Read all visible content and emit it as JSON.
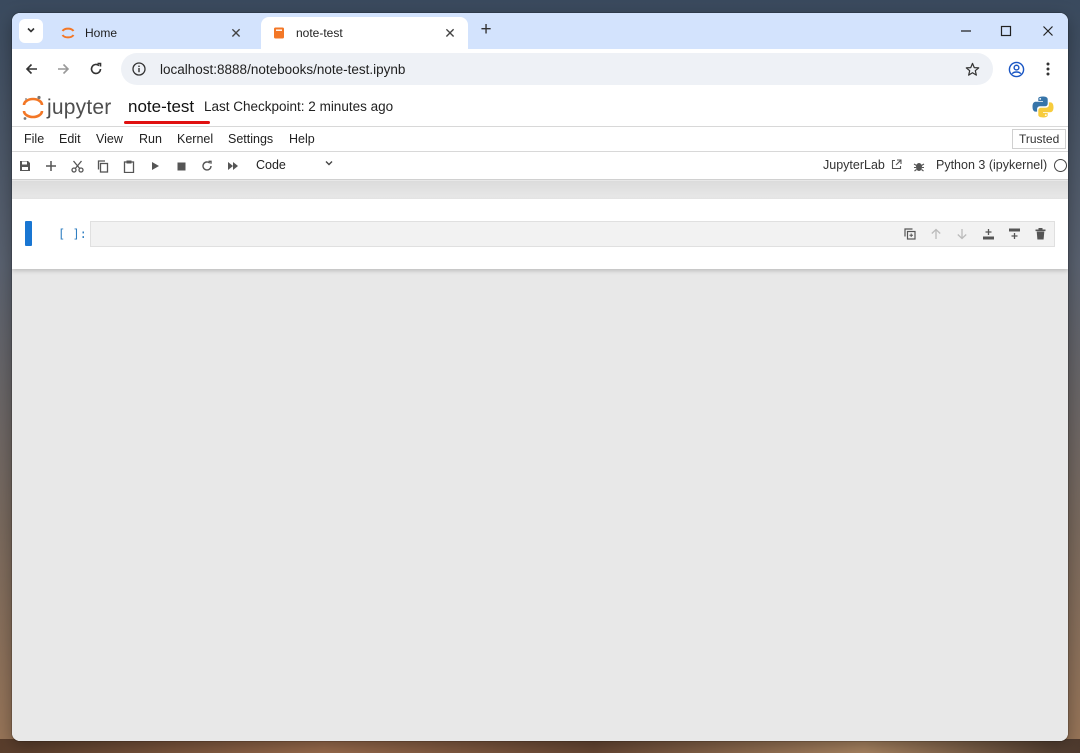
{
  "browser": {
    "tabs": [
      {
        "title": "Home",
        "active": false
      },
      {
        "title": "note-test",
        "active": true
      }
    ],
    "address": "localhost:8888/notebooks/note-test.ipynb",
    "icons": {
      "tab_search": "chevron-down-icon",
      "new_tab": "plus-icon",
      "back": "arrow-left-icon",
      "forward": "arrow-right-icon",
      "reload": "reload-icon",
      "site_info": "info-icon",
      "bookmark": "star-icon",
      "profile": "profile-icon",
      "menu": "kebab-icon"
    }
  },
  "jupyter": {
    "logo_text": "jupyter",
    "notebook_name": "note-test",
    "checkpoint": "Last Checkpoint: 2 minutes ago",
    "menu": [
      "File",
      "Edit",
      "View",
      "Run",
      "Kernel",
      "Settings",
      "Help"
    ],
    "trusted": "Trusted",
    "cell_type": "Code",
    "jupyterlab_link": "JupyterLab",
    "kernel": "Python 3 (ipykernel)",
    "kernel_status": "idle"
  },
  "cells": [
    {
      "prompt": "[ ]:",
      "source": ""
    }
  ],
  "colors": {
    "tabstrip": "#d3e3fd",
    "jupyter_orange": "#f37726",
    "cell_active": "#1976d2",
    "annotation_underline": "#e01010"
  }
}
